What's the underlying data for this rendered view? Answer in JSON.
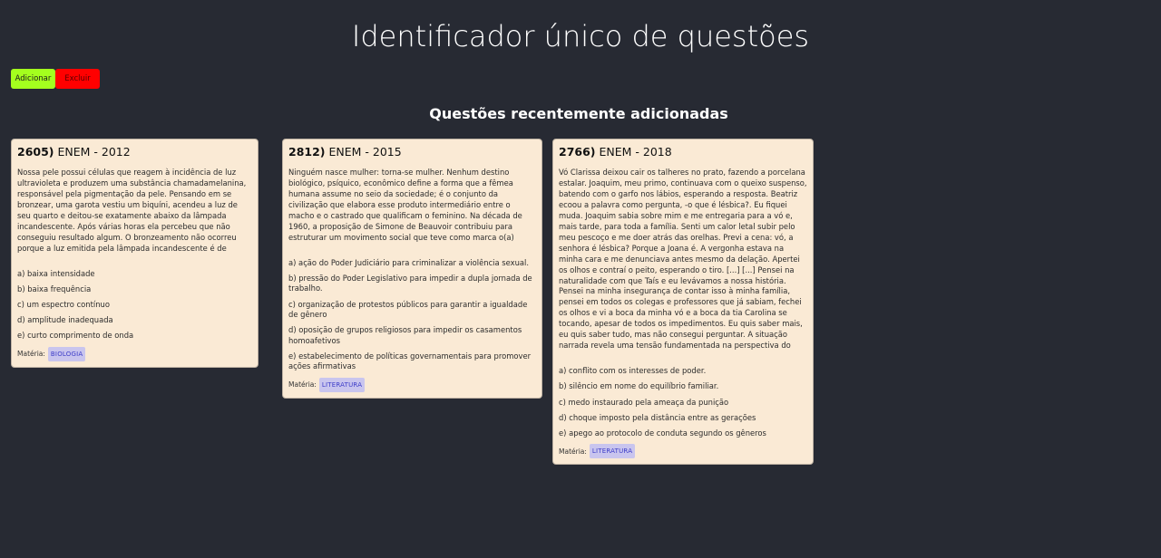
{
  "page": {
    "title": "Identificador único de questões"
  },
  "toolbar": {
    "add_label": "Adicionar",
    "delete_label": "Excluir"
  },
  "recent": {
    "heading": "Questões recentemente adicionadas",
    "subject_label": "Matéria:",
    "cards": [
      {
        "id": "2605",
        "paren": ")",
        "exam": " ENEM - 2012",
        "statement": "Nossa pele possui células que reagem à incidência de luz ultravioleta e produzem uma substância chamadamelanina, responsável pela pigmentação da pele. Pensando em se bronzear, uma garota vestiu um biquíni, acendeu a luz de seu quarto e deitou-se exatamente abaixo da lâmpada incandescente. Após várias horas ela percebeu que não conseguiu resultado algum. O bronzeamento não ocorreu porque a luz emitida pela lâmpada incandescente é de",
        "options": [
          "a) baixa intensidade",
          "b) baixa frequência",
          "c) um espectro contínuo",
          "d) amplitude inadequada",
          "e) curto comprimento de onda"
        ],
        "subject": "BIOLOGIA"
      },
      {
        "id": "2812",
        "paren": ")",
        "exam": " ENEM - 2015",
        "statement": "Ninguém nasce mulher: torna-se mulher. Nenhum destino biológico, psíquico, econômico define a forma que a fêmea humana assume no seio da sociedade; é o conjunto da civilização que elabora esse produto intermediário entre o macho e o castrado que qualificam o feminino. Na década de 1960, a proposição de Simone de Beauvoir contribuiu para estruturar um movimento social que teve como marca o(a)",
        "options": [
          "a) ação do Poder Judiciário para criminalizar a violência sexual.",
          "b) pressão do Poder Legislativo para impedir a dupla jornada de trabalho.",
          "c) organização de protestos públicos para garantir a igualdade de gênero",
          "d) oposição de grupos religiosos para impedir os casamentos homoafetivos",
          "e) estabelecimento de políticas governamentais para promover ações afirmativas"
        ],
        "subject": "LITERATURA"
      },
      {
        "id": "2766",
        "paren": ")",
        "exam": " ENEM - 2018",
        "statement": "Vó Clarissa deixou cair os talheres no prato, fazendo a porcelana estalar. Joaquim, meu primo, continuava com o queixo suspenso, batendo com o garfo nos lábios, esperando a resposta. Beatriz ecoou a palavra como pergunta, -o que é lésbica?. Eu fiquei muda. Joaquim sabia sobre mim e me entregaria para a vó e, mais tarde, para toda a família. Senti um calor letal subir pelo meu pescoço e me doer atrás das orelhas. Previ a cena: vó, a senhora é lésbica? Porque a Joana é. A vergonha estava na minha cara e me denunciava antes mesmo da delação. Apertei os olhos e contraí o peito, esperando o tiro. [...] [...] Pensei na naturalidade com que Taís e eu levávamos a nossa história. Pensei na minha insegurança de contar isso à minha família, pensei em todos os colegas e professores que já sabiam, fechei os olhos e vi a boca da minha vó e a boca da tia Carolina se tocando, apesar de todos os impedimentos. Eu quis saber mais, eu quis saber tudo, mas não consegui perguntar. A situação narrada revela uma tensão fundamentada na perspectiva do",
        "options": [
          "a) conflito com os interesses de poder.",
          "b) silêncio em nome do equilíbrio familiar.",
          "c) medo instaurado pela ameaça da punição",
          "d) choque imposto pela distância entre as gerações",
          "e) apego ao protocolo de conduta segundo os gêneros"
        ],
        "subject": "LITERATURA"
      }
    ]
  },
  "colors": {
    "background": "#272a33",
    "card": "#faead5",
    "add_button": "#a4ff1e",
    "delete_button": "#ff0000",
    "subject_tag": "#c9c5ee",
    "subject_tag_text": "#3c3cc8"
  }
}
